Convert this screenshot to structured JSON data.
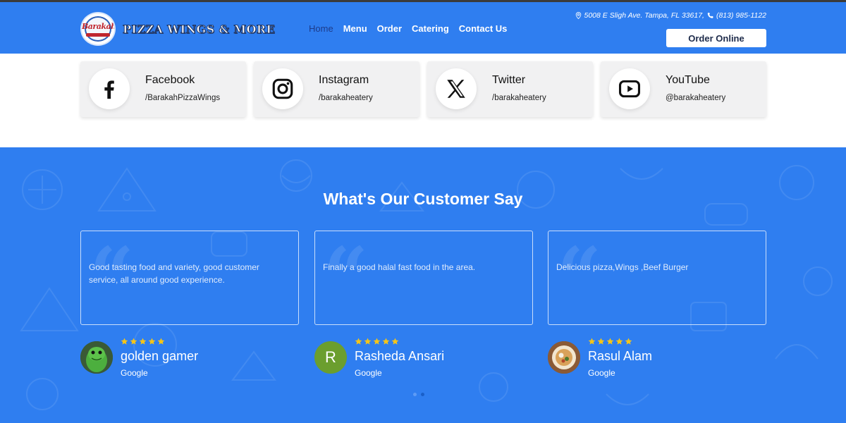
{
  "brand": {
    "logo_text": "Barakah",
    "name": "PIZZA WINGS & MORE"
  },
  "nav": {
    "items": [
      "Home",
      "Menu",
      "Order",
      "Catering",
      "Contact Us"
    ]
  },
  "contact": {
    "address": "5008 E Sligh Ave. Tampa, FL 33617,",
    "phone": "(813) 985-1122"
  },
  "header": {
    "order_button": "Order Online"
  },
  "socials": [
    {
      "network": "Facebook",
      "handle": "/BarakahPizzaWings",
      "icon": "facebook-icon"
    },
    {
      "network": "Instagram",
      "handle": "/barakaheatery",
      "icon": "instagram-icon"
    },
    {
      "network": "Twitter",
      "handle": "/barakaheatery",
      "icon": "x-icon"
    },
    {
      "network": "YouTube",
      "handle": "@barakaheatery",
      "icon": "youtube-icon"
    }
  ],
  "reviews": {
    "title": "What's Our Customer Say",
    "items": [
      {
        "text": "Good tasting food and variety, good customer service, all around good experience.",
        "name": "golden gamer",
        "source": "Google",
        "stars": 5,
        "avatar": "dinosaur-avatar"
      },
      {
        "text": "Finally a good halal fast food in the area.",
        "name": "Rasheda Ansari",
        "source": "Google",
        "stars": 5,
        "avatar_letter": "R"
      },
      {
        "text": "Delicious pizza,Wings ,Beef Burger",
        "name": "Rasul Alam",
        "source": "Google",
        "stars": 5,
        "avatar": "food-bowl-avatar"
      }
    ],
    "current_page": 2,
    "page_count": 2
  },
  "colors": {
    "primary": "#2f7ef0",
    "nav_active": "#1d3b8a",
    "star": "#f5c518"
  }
}
